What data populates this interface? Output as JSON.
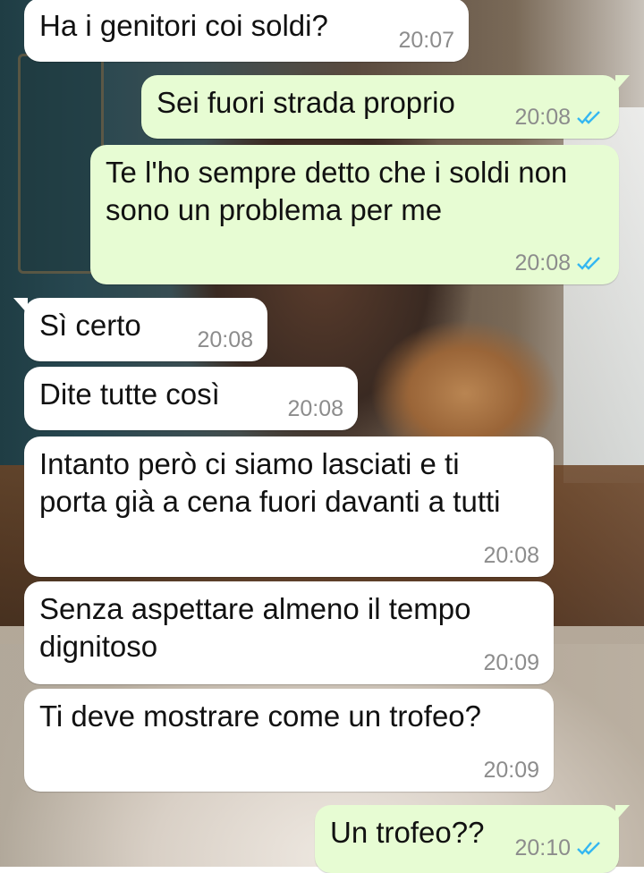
{
  "colors": {
    "incoming_bubble": "#ffffff",
    "outgoing_bubble": "#e7fcd3",
    "timestamp": "#8c8c8c",
    "read_ticks": "#34b7f1"
  },
  "messages": [
    {
      "direction": "incoming",
      "text": "Ha i genitori coi soldi?",
      "time": "20:07"
    },
    {
      "direction": "outgoing",
      "text": "Sei fuori strada proprio",
      "time": "20:08",
      "status": "read-double-tick-icon"
    },
    {
      "direction": "outgoing",
      "text": "Te l'ho sempre detto che i soldi non sono un problema per me",
      "time": "20:08",
      "status": "read-double-tick-icon"
    },
    {
      "direction": "incoming",
      "text": "Sì certo",
      "time": "20:08"
    },
    {
      "direction": "incoming",
      "text": "Dite tutte così",
      "time": "20:08"
    },
    {
      "direction": "incoming",
      "text": "Intanto però ci siamo lasciati e ti porta già a cena fuori davanti a tutti",
      "time": "20:08"
    },
    {
      "direction": "incoming",
      "text": "Senza aspettare almeno il tempo dignitoso",
      "time": "20:09"
    },
    {
      "direction": "incoming",
      "text": "Ti deve mostrare come un trofeo?",
      "time": "20:09"
    },
    {
      "direction": "outgoing",
      "text": "Un trofeo??",
      "time": "20:10",
      "status": "read-double-tick-icon"
    }
  ]
}
